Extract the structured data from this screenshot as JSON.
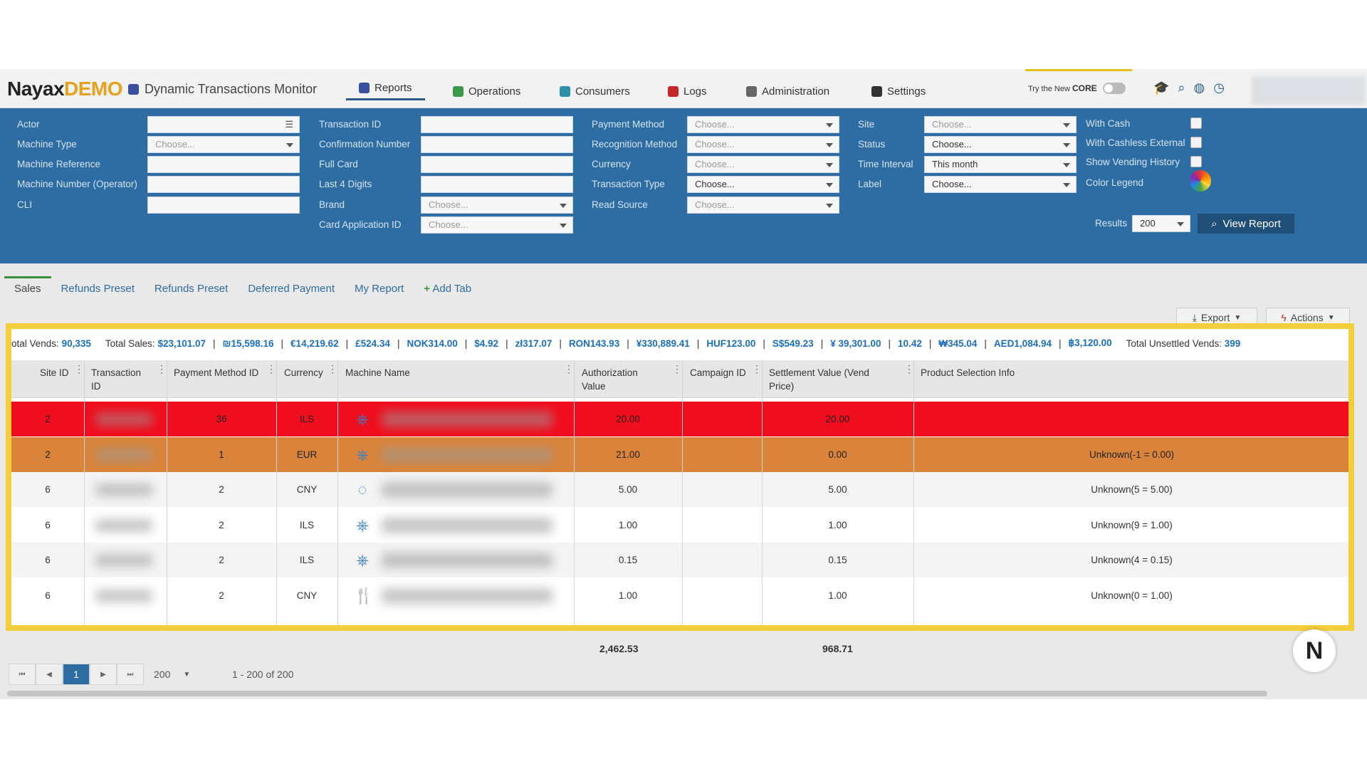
{
  "header": {
    "logo_main": "Nayax",
    "logo_demo": "DEMO",
    "app_title": "Dynamic Transactions Monitor",
    "nav": [
      {
        "label": "Reports",
        "icon": "reports-icon",
        "color": "#3b4fa0"
      },
      {
        "label": "Operations",
        "icon": "operations-icon",
        "color": "#3a9a4a"
      },
      {
        "label": "Consumers",
        "icon": "consumers-icon",
        "color": "#2c8fa8"
      },
      {
        "label": "Logs",
        "icon": "logs-icon",
        "color": "#c62828"
      },
      {
        "label": "Administration",
        "icon": "administration-icon",
        "color": "#666666"
      },
      {
        "label": "Settings",
        "icon": "settings-icon",
        "color": "#333333"
      }
    ],
    "try_new_prefix": "Try the",
    "try_new_word": "New",
    "try_new_brand": "CORE"
  },
  "filters": {
    "actor": "Actor",
    "machine_type": "Machine Type",
    "machine_reference": "Machine Reference",
    "machine_number": "Machine Number (Operator)",
    "cli": "CLI",
    "transaction_id": "Transaction ID",
    "confirmation_number": "Confirmation Number",
    "full_card": "Full Card",
    "last4": "Last 4 Digits",
    "brand": "Brand",
    "card_app_id": "Card Application ID",
    "payment_method": "Payment Method",
    "recognition_method": "Recognition Method",
    "currency": "Currency",
    "transaction_type": "Transaction Type",
    "read_source": "Read Source",
    "site": "Site",
    "status": "Status",
    "time_interval": "Time Interval",
    "label": "Label",
    "with_cash": "With Cash",
    "with_cashless": "With Cashless External",
    "show_vending": "Show Vending History",
    "color_legend": "Color Legend",
    "results": "Results",
    "results_value": "200",
    "choose": "Choose...",
    "time_interval_value": "This month",
    "view_report": "View Report"
  },
  "tabs": [
    "Sales",
    "Refunds Preset",
    "Refunds Preset",
    "Deferred Payment",
    "My Report",
    "Add Tab"
  ],
  "toolbar": {
    "export": "Export",
    "actions": "Actions"
  },
  "totals": {
    "vends_label": "otal Vends:",
    "vends": "90,335",
    "sales_label": "Total Sales:",
    "amounts": [
      "$23,101.07",
      "₪15,598.16",
      "€14,219.62",
      "£524.34",
      "NOK314.00",
      "$4.92",
      "zł317.07",
      "RON143.93",
      "¥330,889.41",
      "HUF123.00",
      "S$549.23",
      "¥ 39,301.00",
      "10.42",
      "₩345.04",
      "AED1,084.94",
      "฿3,120.00"
    ],
    "unsettled_label": "Total Unsettled Vends:",
    "unsettled": "399"
  },
  "table": {
    "headers": {
      "site_id": "Site ID",
      "transaction_id": "Transaction ID",
      "payment_method_id": "Payment Method ID",
      "currency": "Currency",
      "machine_name": "Machine Name",
      "authorization_value": "Authorization Value",
      "campaign_id": "Campaign ID",
      "settlement_value": "Settlement Value (Vend Price)",
      "product_selection": "Product Selection Info"
    },
    "rows": [
      {
        "site": "2",
        "pm": "36",
        "currency": "ILS",
        "icon": "wheel-icon",
        "auth": "20.00",
        "settle": "20.00",
        "product": "",
        "bg": "#f00d1d"
      },
      {
        "site": "2",
        "pm": "1",
        "currency": "EUR",
        "icon": "wheel-icon",
        "auth": "21.00",
        "settle": "0.00",
        "product": "Unknown(-1 = 0.00)",
        "bg": "#d9843a"
      },
      {
        "site": "6",
        "pm": "2",
        "currency": "CNY",
        "icon": "dots-icon",
        "auth": "5.00",
        "settle": "5.00",
        "product": "Unknown(5 = 5.00)",
        "bg": "#f4f4f4"
      },
      {
        "site": "6",
        "pm": "2",
        "currency": "ILS",
        "icon": "wheel-icon",
        "auth": "1.00",
        "settle": "1.00",
        "product": "Unknown(9 = 1.00)",
        "bg": "#ffffff"
      },
      {
        "site": "6",
        "pm": "2",
        "currency": "ILS",
        "icon": "wheel-icon",
        "auth": "0.15",
        "settle": "0.15",
        "product": "Unknown(4 = 0.15)",
        "bg": "#f4f4f4"
      },
      {
        "site": "6",
        "pm": "2",
        "currency": "CNY",
        "icon": "fork-knife-icon",
        "auth": "1.00",
        "settle": "1.00",
        "product": "Unknown(0 = 1.00)",
        "bg": "#ffffff"
      }
    ]
  },
  "summary": {
    "auth_total": "2,462.53",
    "settle_total": "968.71"
  },
  "pager": {
    "current": "1",
    "page_size": "200",
    "range": "1 - 200 of 200"
  }
}
